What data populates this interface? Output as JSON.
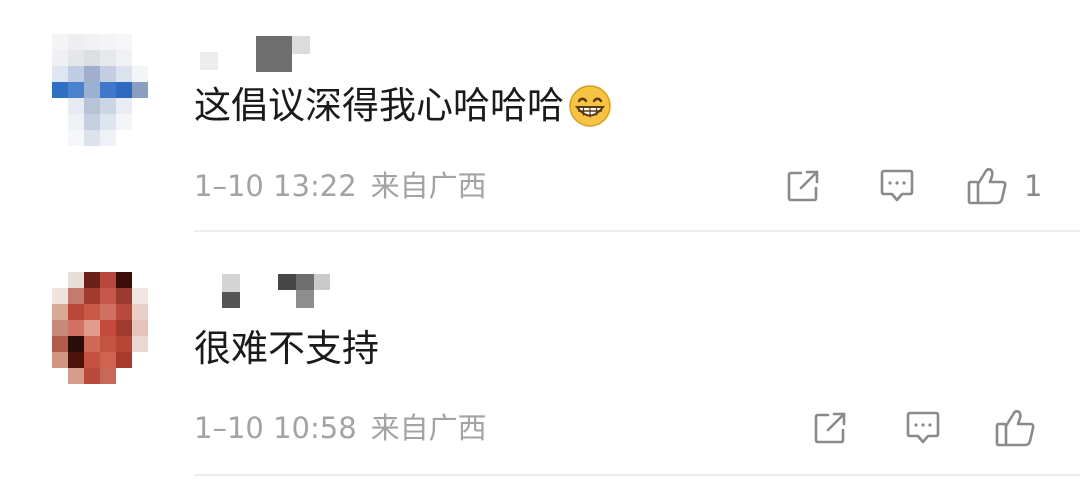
{
  "comments": [
    {
      "text": "这倡议深得我心哈哈哈",
      "emoji": "grinning-face-emoji",
      "time": "1–10 13:22",
      "location": "来自广西",
      "like_count": "1"
    },
    {
      "text": "很难不支持",
      "time": "1–10 10:58",
      "location": "来自广西",
      "like_count": ""
    }
  ],
  "icons": {
    "share": "share-icon",
    "reply": "comment-icon",
    "like": "thumbs-up-icon"
  },
  "colors": {
    "text": "#1a1a1a",
    "meta": "#a3a3a3",
    "icon": "#8a8a8a",
    "divider": "#ececec"
  }
}
